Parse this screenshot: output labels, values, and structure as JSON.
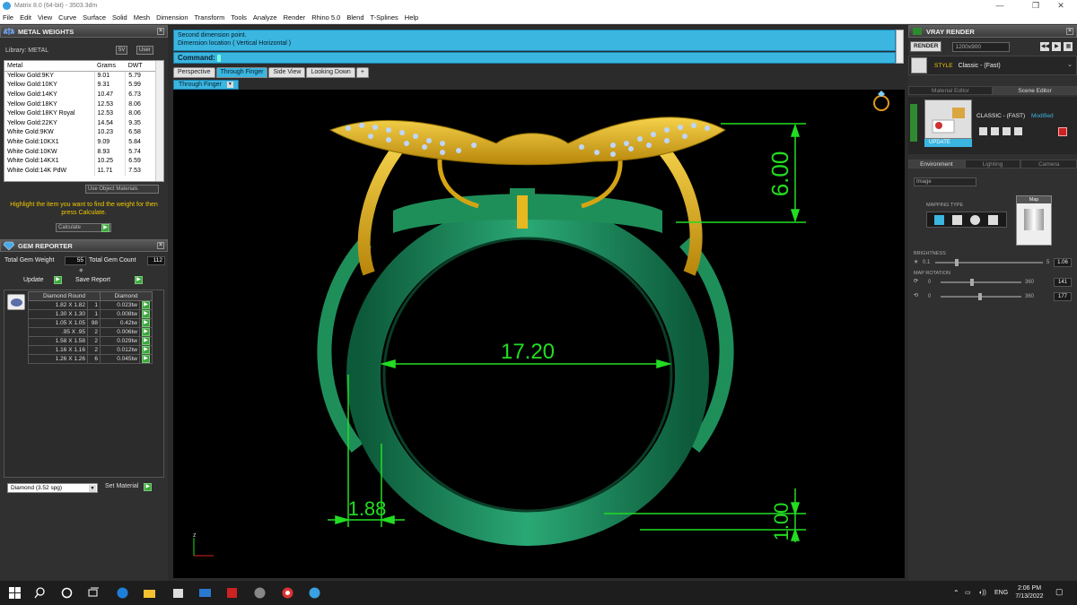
{
  "window": {
    "title": "Matrix 8.0 (64-bit) - 3503.3dm",
    "minimize": "—",
    "maximize": "❐",
    "close": "✕"
  },
  "menu": [
    "File",
    "Edit",
    "View",
    "Curve",
    "Surface",
    "Solid",
    "Mesh",
    "Dimension",
    "Transform",
    "Tools",
    "Analyze",
    "Render",
    "Rhino 5.0",
    "Blend",
    "T-Splines",
    "Help"
  ],
  "metal_weights": {
    "title": "METAL WEIGHTS",
    "library_label": "Library: METAL",
    "btn_5v": "5V",
    "btn_user": "User",
    "columns": [
      "Metal",
      "Grams",
      "DWT"
    ],
    "rows": [
      [
        "Yellow Gold:9KY",
        "9.01",
        "5.79"
      ],
      [
        "Yellow Gold:10KY",
        "9.31",
        "5.99"
      ],
      [
        "Yellow Gold:14KY",
        "10.47",
        "6.73"
      ],
      [
        "Yellow Gold:18KY",
        "12.53",
        "8.06"
      ],
      [
        "Yellow Gold:18KY Royal",
        "12.53",
        "8.06"
      ],
      [
        "Yellow Gold:22KY",
        "14.54",
        "9.35"
      ],
      [
        "White Gold:9KW",
        "10.23",
        "6.58"
      ],
      [
        "White Gold:10KX1",
        "9.09",
        "5.84"
      ],
      [
        "White Gold:10KW",
        "8.93",
        "5.74"
      ],
      [
        "White Gold:14KX1",
        "10.25",
        "6.59"
      ],
      [
        "White Gold:14K PdW",
        "11.71",
        "7.53"
      ]
    ],
    "use_object_materials": "Use Object Materials",
    "hint": "Highlight the item you want to find the weight for then press Calculate.",
    "calculate": "Calculate"
  },
  "gem_reporter": {
    "title": "GEM REPORTER",
    "total_weight_label": "Total Gem Weight",
    "total_weight": "55",
    "total_count_label": "Total Gem Count",
    "total_count": "112",
    "update": "Update",
    "save_report": "Save Report",
    "columns": [
      "Diamond Round",
      "",
      "Diamond"
    ],
    "rows": [
      [
        "1.82 X 1.82",
        "1",
        "0.023tw"
      ],
      [
        "1.30 X 1.30",
        "1",
        "0.008tw"
      ],
      [
        "1.05 X 1.05",
        "98",
        "0.42tw"
      ],
      [
        ".95 X .95",
        "2",
        "0.006tw"
      ],
      [
        "1.58 X 1.58",
        "2",
        "0.029tw"
      ],
      [
        "1.16 X 1.16",
        "2",
        "0.012tw"
      ],
      [
        "1.26 X 1.26",
        "6",
        "0.045tw"
      ]
    ],
    "material": "Diamond    (3.52 spg)",
    "set_material": "Set Material"
  },
  "command": {
    "line1": "Second dimension point.",
    "line2": "Dimension location ( Vertical  Horizontal )",
    "prompt": "Command:"
  },
  "view_tabs": [
    "Perspective",
    "Through Finger",
    "Side View",
    "Looking Down",
    "+"
  ],
  "active_view": "Through Finger",
  "dimensions": {
    "top_height": "6.00",
    "inner_width": "17.20",
    "band_width": "1.88",
    "band_thickness": "1.00"
  },
  "axis_label": "z",
  "vray": {
    "title": "VRAY RENDER",
    "render": "RENDER",
    "resolution": "1200x900",
    "style_label": "STYLE",
    "style_value": "Classic - (Fast)",
    "tab_material": "Material Editor",
    "tab_scene": "Scene Editor",
    "material_name": "CLASSIC - (FAST)",
    "modified": "Modified",
    "update": "UPDATE",
    "env_tabs": [
      "Environment",
      "Lighting",
      "Camera"
    ],
    "env_type": "Image",
    "mapping_type": "MAPPING TYPE",
    "map": "Map",
    "brightness_label": "BRIGHTNESS",
    "brightness_min": "0.1",
    "brightness_max": "5",
    "brightness": "1.06",
    "map_rotation_label": "MAP ROTATION",
    "rot1_min": "0",
    "rot1_max": "360",
    "rot1": "141",
    "rot2_min": "0",
    "rot2_max": "360",
    "rot2": "177"
  },
  "taskbar": {
    "lang": "ENG",
    "time": "2:06 PM",
    "date": "7/13/2022"
  },
  "colors": {
    "accent": "#3ab6e0",
    "dimension": "#22dd22",
    "gold": "#e8b820",
    "ring_green": "#1f8f5a"
  }
}
